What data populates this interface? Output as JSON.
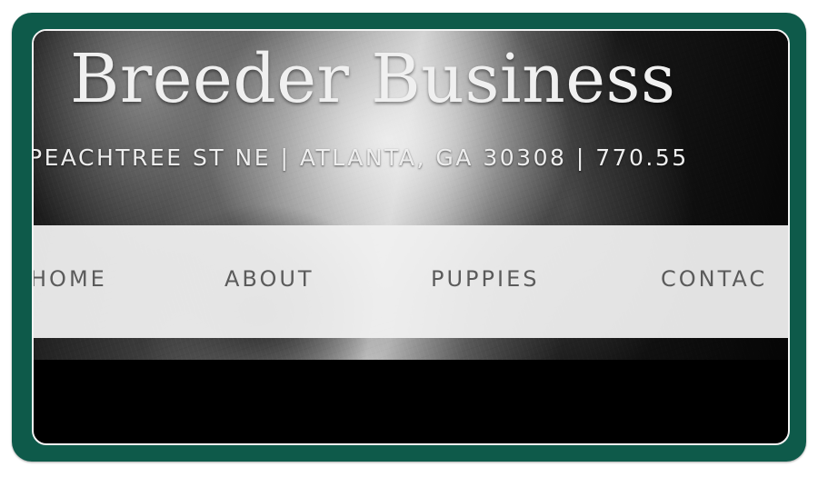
{
  "header": {
    "site_title": "Breeder Business",
    "address_line": "PEACHTREE ST NE | ATLANTA, GA 30308 | 770.55"
  },
  "nav": {
    "items": [
      {
        "label": "HOME"
      },
      {
        "label": "ABOUT"
      },
      {
        "label": "PUPPIES"
      },
      {
        "label": "CONTAC"
      }
    ]
  },
  "colors": {
    "frame": "#0e5a4a",
    "nav_background": "#f0f0f0",
    "nav_text": "#5b5b5b",
    "title_text": "#f0f0f0"
  },
  "icons": []
}
